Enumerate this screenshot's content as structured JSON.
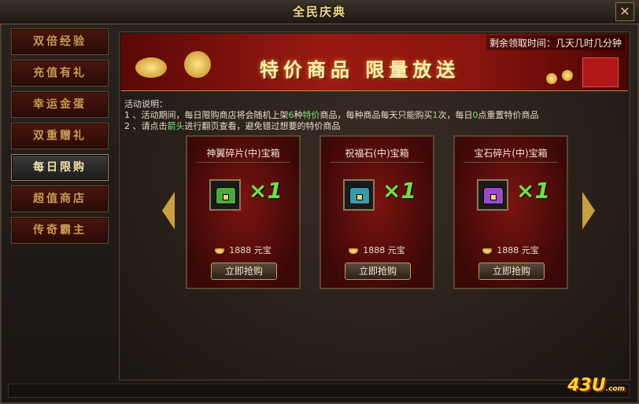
{
  "window": {
    "title": "全民庆典",
    "close_label": "✕"
  },
  "sidebar": {
    "items": [
      {
        "label": "双倍经验",
        "active": false
      },
      {
        "label": "充值有礼",
        "active": false
      },
      {
        "label": "幸运金蛋",
        "active": false
      },
      {
        "label": "双重赠礼",
        "active": false
      },
      {
        "label": "每日限购",
        "active": true
      },
      {
        "label": "超值商店",
        "active": false
      },
      {
        "label": "传奇霸主",
        "active": false
      }
    ]
  },
  "banner": {
    "text": "特价商品 限量放送",
    "timer": "剩余领取时间：几天几时几分钟"
  },
  "description": {
    "heading": "活动说明：",
    "line1_pre": "1 、活动期间，每日限购商店将会随机上架",
    "line1_n": "6",
    "line1_mid": "种",
    "line1_hl": "特价",
    "line1_post": "商品，每种商品每天只能购买",
    "line1_n2": "1",
    "line1_post2": "次，每日",
    "line1_n3": "0",
    "line1_post3": "点重置特价商品",
    "line2_pre": "2 、请点击",
    "line2_hl": "箭头",
    "line2_post": "进行翻页查看，避免错过想要的特价商品"
  },
  "products": [
    {
      "name": "神翼碎片(中)宝箱",
      "qty": "×1",
      "price": "1888 元宝",
      "button": "立即抢购",
      "chest_color": "#4caa3a"
    },
    {
      "name": "祝福石(中)宝箱",
      "qty": "×1",
      "price": "1888 元宝",
      "button": "立即抢购",
      "chest_color": "#3a9aaa"
    },
    {
      "name": "宝石碎片(中)宝箱",
      "qty": "×1",
      "price": "1888 元宝",
      "button": "立即抢购",
      "chest_color": "#9a4ac8"
    }
  ],
  "icons": {
    "prev": "arrow-left-icon",
    "next": "arrow-right-icon",
    "currency": "gold-ingot-icon"
  },
  "logo": {
    "text": "43U",
    "suffix": ".com"
  }
}
